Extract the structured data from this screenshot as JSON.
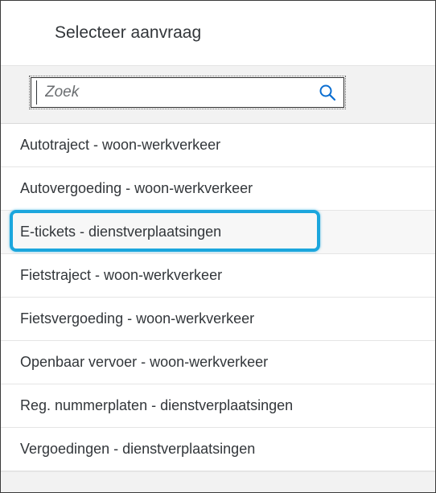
{
  "dialog": {
    "title": "Selecteer aanvraag"
  },
  "search": {
    "placeholder": "Zoek",
    "icon": "search-icon",
    "icon_color": "#0a6ed1"
  },
  "list": {
    "items": [
      {
        "label": "Autotraject - woon-werkverkeer"
      },
      {
        "label": "Autovergoeding - woon-werkverkeer"
      },
      {
        "label": "E-tickets - dienstverplaatsingen"
      },
      {
        "label": "Fietstraject - woon-werkverkeer"
      },
      {
        "label": "Fietsvergoeding - woon-werkverkeer"
      },
      {
        "label": "Openbaar vervoer - woon-werkverkeer"
      },
      {
        "label": "Reg. nummerplaten - dienstverplaatsingen"
      },
      {
        "label": "Vergoedingen - dienstverplaatsingen"
      }
    ],
    "highlighted_item": "E-tickets - dienstverplaatsingen",
    "highlight_color": "#1ba6dd"
  }
}
